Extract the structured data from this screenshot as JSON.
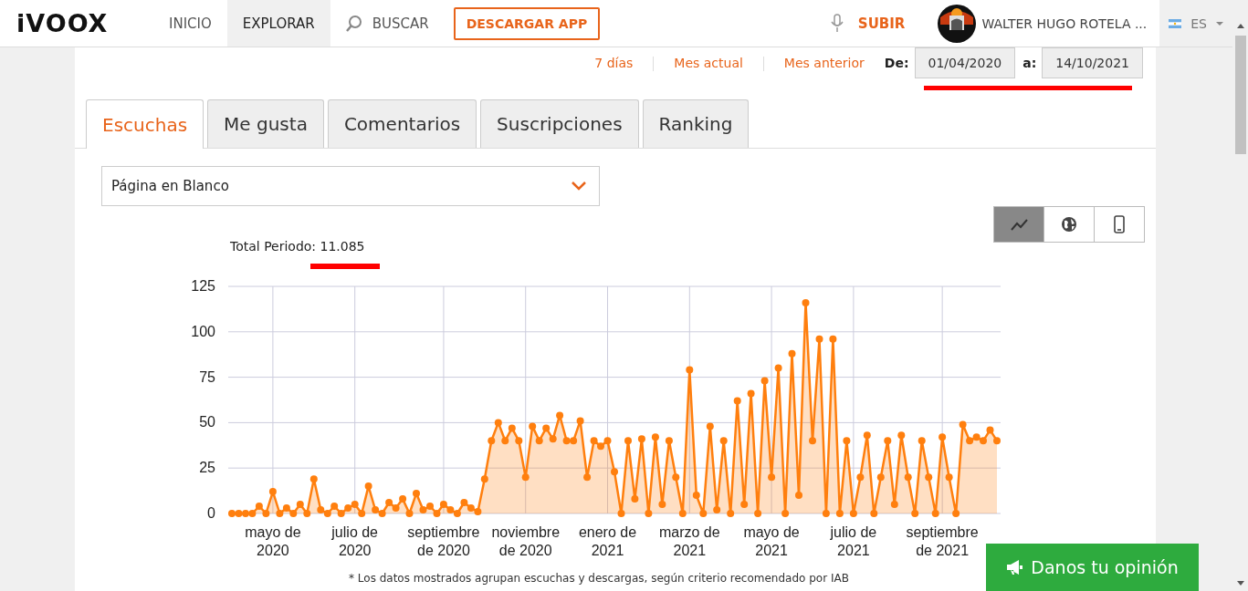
{
  "header": {
    "logo": "iVOOX",
    "nav": [
      {
        "label": "INICIO",
        "selected": false,
        "kind": "link"
      },
      {
        "label": "EXPLORAR",
        "selected": true,
        "kind": "link"
      },
      {
        "label": "BUSCAR",
        "selected": false,
        "kind": "search"
      },
      {
        "label": "DESCARGAR APP",
        "selected": false,
        "kind": "cta"
      }
    ],
    "upload": "SUBIR",
    "user": "WALTER HUGO ROTELA ...",
    "language": "ES"
  },
  "date_range": {
    "presets": [
      "7 días",
      "Mes actual",
      "Mes anterior"
    ],
    "from_label": "De:",
    "from": "01/04/2020",
    "to_label": "a:",
    "to": "14/10/2021",
    "underlined": true
  },
  "tabs": [
    {
      "label": "Escuchas",
      "selected": true
    },
    {
      "label": "Me gusta",
      "selected": false
    },
    {
      "label": "Comentarios",
      "selected": false
    },
    {
      "label": "Suscripciones",
      "selected": false
    },
    {
      "label": "Ranking",
      "selected": false
    }
  ],
  "podcast_select": {
    "value": "Página en Blanco"
  },
  "chart_modes": [
    {
      "kind": "line",
      "selected": true
    },
    {
      "kind": "globe",
      "selected": false
    },
    {
      "kind": "phone",
      "selected": false
    }
  ],
  "total": {
    "text": "Total Periodo: 11.085",
    "underlined": true
  },
  "chart_data": {
    "type": "area",
    "grid": true,
    "ylim": [
      0,
      125
    ],
    "yticks": [
      0,
      25,
      50,
      75,
      100,
      125
    ],
    "categories": [
      null,
      null,
      null,
      null,
      null,
      null,
      "mayo de\n2020",
      null,
      null,
      null,
      null,
      null,
      null,
      null,
      null,
      null,
      null,
      null,
      "julio de\n2020",
      null,
      null,
      null,
      null,
      null,
      null,
      null,
      null,
      null,
      null,
      null,
      null,
      "septiembre\nde 2020",
      null,
      null,
      null,
      null,
      null,
      null,
      null,
      null,
      null,
      null,
      null,
      "noviembre\nde 2020",
      null,
      null,
      null,
      null,
      null,
      null,
      null,
      null,
      null,
      null,
      null,
      "enero de\n2021",
      null,
      null,
      null,
      null,
      null,
      null,
      null,
      null,
      null,
      null,
      null,
      "marzo de\n2021",
      null,
      null,
      null,
      null,
      null,
      null,
      null,
      null,
      null,
      null,
      null,
      "mayo de\n2021",
      null,
      null,
      null,
      null,
      null,
      null,
      null,
      null,
      null,
      null,
      null,
      "julio de\n2021",
      null,
      null,
      null,
      null,
      null,
      null,
      null,
      null,
      null,
      null,
      null,
      null,
      "septiembre\nde 2021",
      null,
      null,
      null,
      null,
      null,
      null,
      null,
      null
    ],
    "series": [
      {
        "color": "#ff7f0e",
        "values": [
          0,
          0,
          0,
          0,
          4,
          0,
          12,
          0,
          3,
          0,
          5,
          0,
          19,
          2,
          0,
          4,
          0,
          3,
          5,
          0,
          15,
          2,
          0,
          6,
          3,
          8,
          0,
          11,
          2,
          4,
          0,
          5,
          2,
          0,
          6,
          3,
          1,
          19,
          40,
          50,
          40,
          47,
          40,
          20,
          48,
          40,
          47,
          41,
          54,
          40,
          40,
          51,
          20,
          40,
          37,
          40,
          23,
          0,
          40,
          8,
          41,
          0,
          42,
          5,
          40,
          20,
          0,
          79,
          10,
          0,
          48,
          2,
          40,
          0,
          62,
          5,
          66,
          0,
          73,
          20,
          80,
          0,
          88,
          10,
          116,
          40,
          96,
          0,
          96,
          0,
          40,
          0,
          20,
          43,
          0,
          20,
          40,
          5,
          43,
          20,
          0,
          40,
          20,
          0,
          42,
          20,
          0,
          49,
          40,
          42,
          40,
          46,
          40
        ]
      }
    ]
  },
  "footnote": "* Los datos mostrados agrupan escuchas y descargas, según criterio recomendado por IAB",
  "feedback_button": "Danos tu opinión"
}
